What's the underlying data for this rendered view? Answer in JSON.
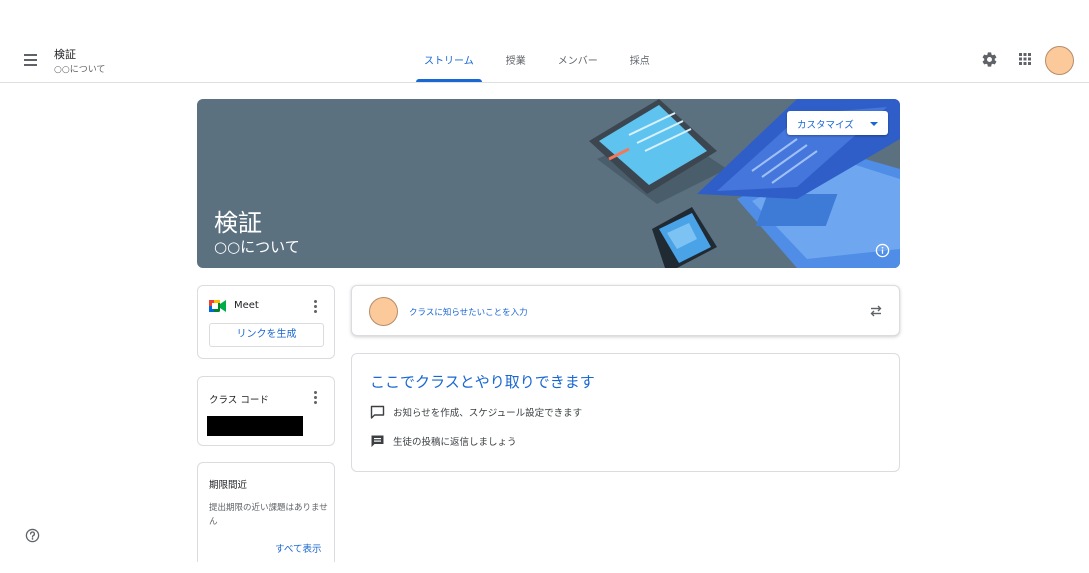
{
  "header": {
    "class_name": "検証",
    "class_section": "○○について",
    "tabs": [
      {
        "label": "ストリーム",
        "active": true
      },
      {
        "label": "授業",
        "active": false
      },
      {
        "label": "メンバー",
        "active": false
      },
      {
        "label": "採点",
        "active": false
      }
    ],
    "icons": [
      "menu-icon",
      "gear-icon",
      "apps-grid-icon",
      "avatar"
    ]
  },
  "banner": {
    "title": "検証",
    "subtitle": "○○について",
    "customize_label": "カスタマイズ",
    "background_color": "#5c717f"
  },
  "meet": {
    "label": "Meet",
    "generate_link_label": "リンクを生成"
  },
  "class_code": {
    "label": "クラス コード"
  },
  "upcoming": {
    "title": "期限間近",
    "empty_text": "提出期限の近い課題はありません",
    "view_all_label": "すべて表示"
  },
  "announce": {
    "prompt": "クラスに知らせたいことを入力"
  },
  "info": {
    "title": "ここでクラスとやり取りできます",
    "lines": [
      "お知らせを作成、スケジュール設定できます",
      "生徒の投稿に返信しましょう"
    ]
  },
  "colors": {
    "accent": "#1967d2",
    "avatar": "#fcc99b"
  }
}
